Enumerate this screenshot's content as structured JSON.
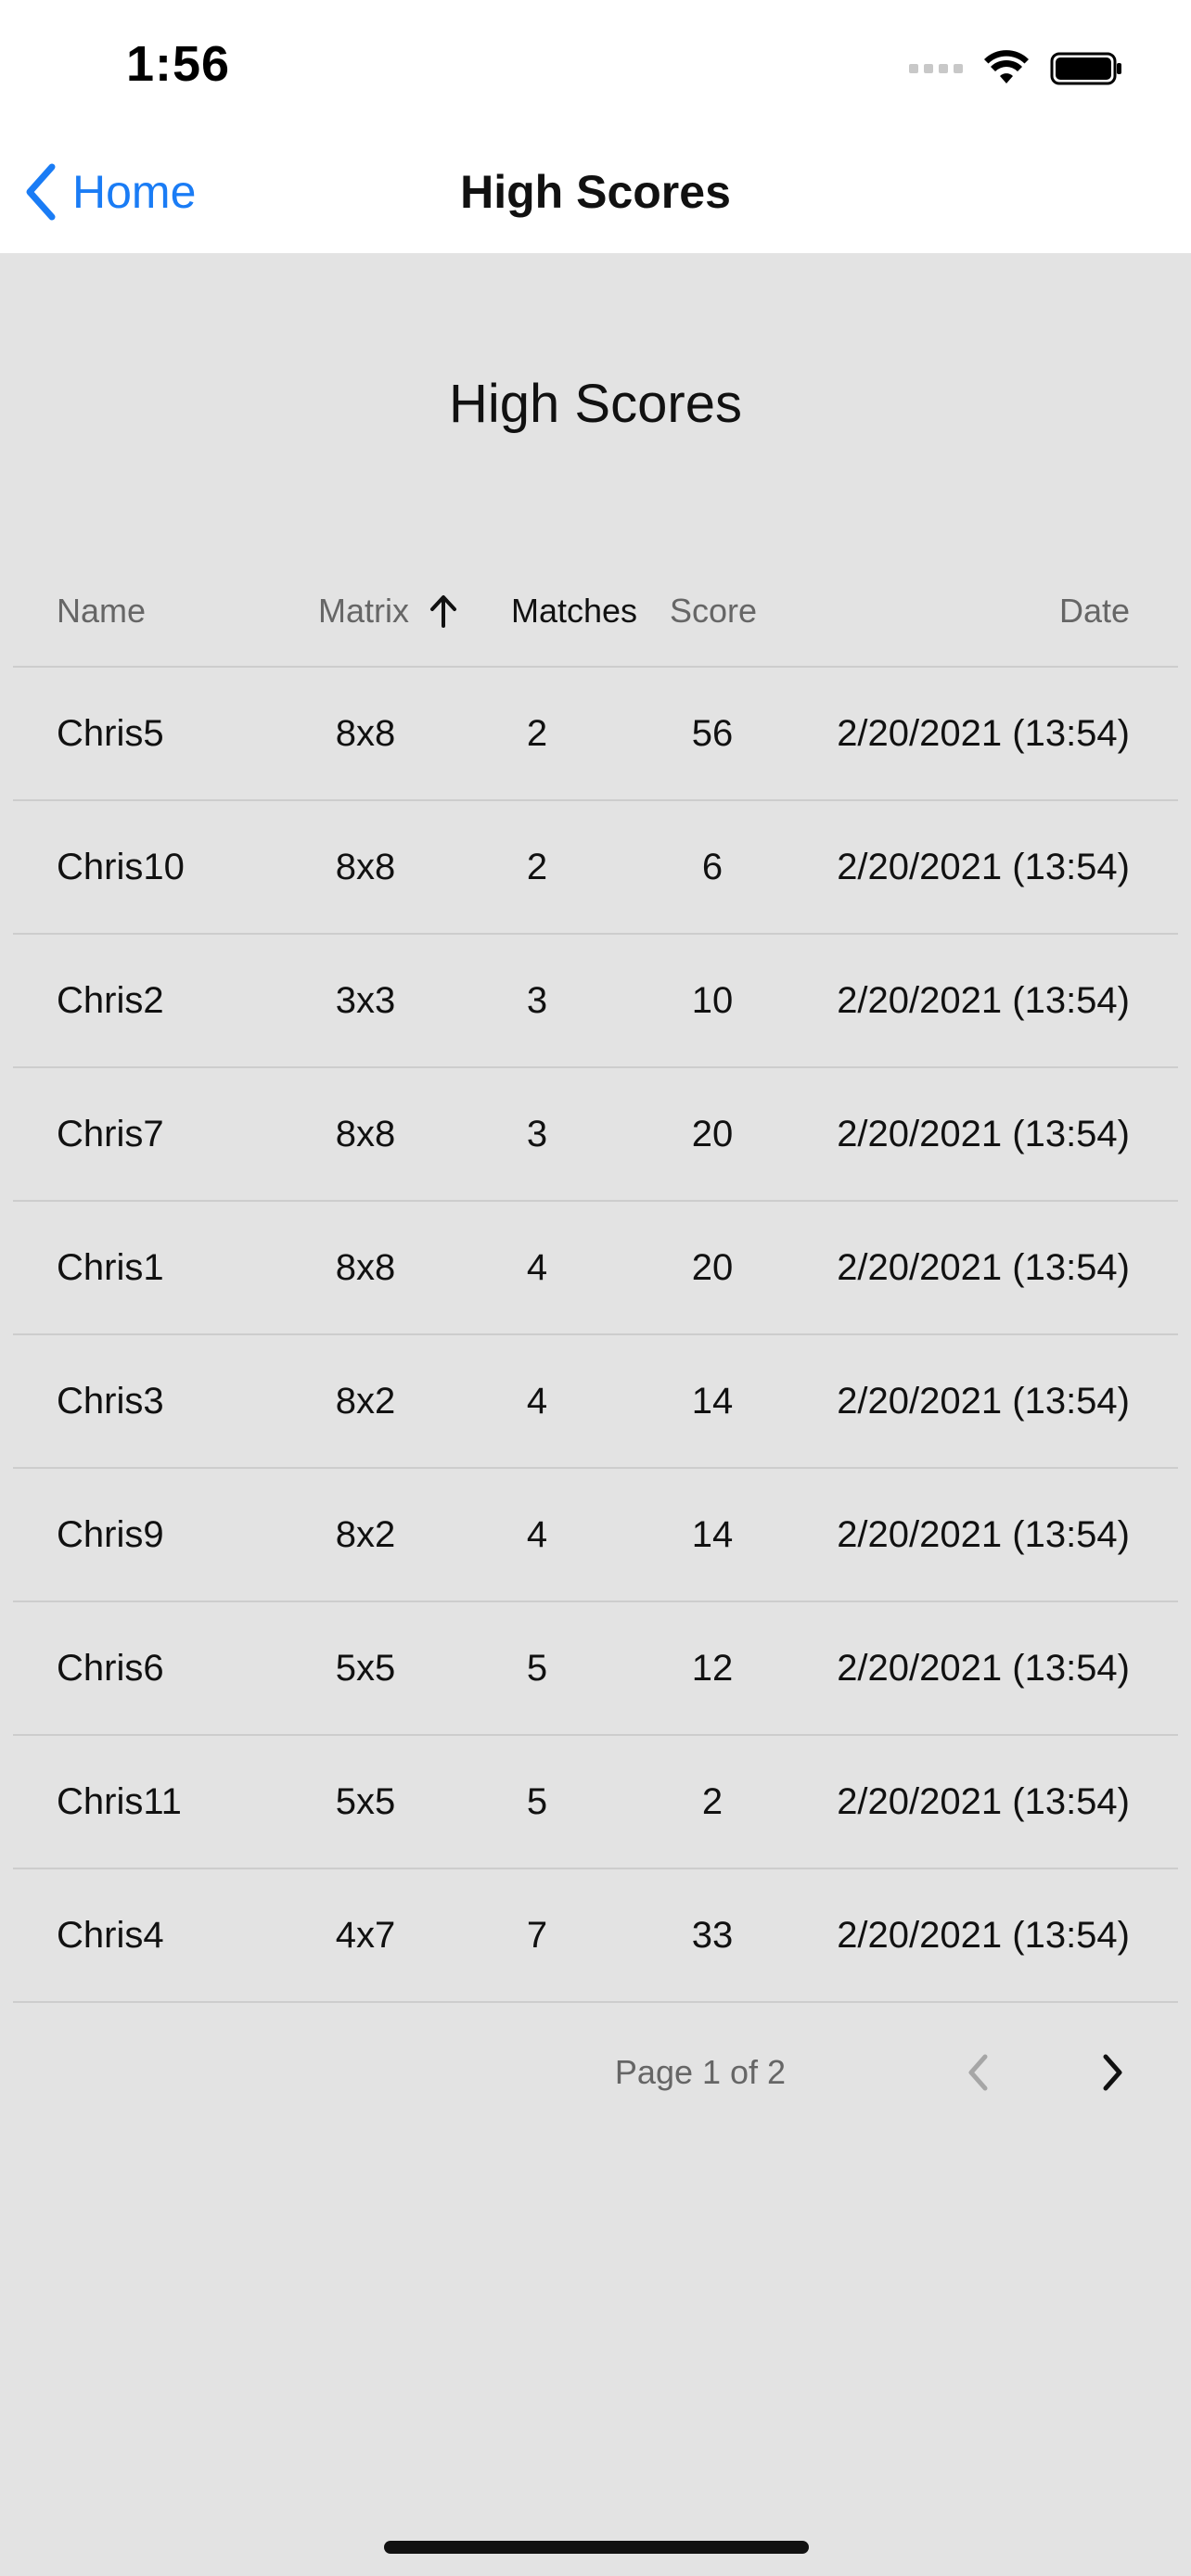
{
  "status_bar": {
    "time": "1:56"
  },
  "nav": {
    "back_label": "Home",
    "title": "High Scores"
  },
  "page": {
    "heading": "High Scores"
  },
  "table": {
    "columns": {
      "name": "Name",
      "matrix": "Matrix",
      "matches": "Matches",
      "score": "Score",
      "date": "Date"
    },
    "sorted_column": "matches",
    "sort_direction": "ascending",
    "rows": [
      {
        "name": "Chris5",
        "matrix": "8x8",
        "matches": "2",
        "score": "56",
        "date": "2/20/2021 (13:54)"
      },
      {
        "name": "Chris10",
        "matrix": "8x8",
        "matches": "2",
        "score": "6",
        "date": "2/20/2021 (13:54)"
      },
      {
        "name": "Chris2",
        "matrix": "3x3",
        "matches": "3",
        "score": "10",
        "date": "2/20/2021 (13:54)"
      },
      {
        "name": "Chris7",
        "matrix": "8x8",
        "matches": "3",
        "score": "20",
        "date": "2/20/2021 (13:54)"
      },
      {
        "name": "Chris1",
        "matrix": "8x8",
        "matches": "4",
        "score": "20",
        "date": "2/20/2021 (13:54)"
      },
      {
        "name": "Chris3",
        "matrix": "8x2",
        "matches": "4",
        "score": "14",
        "date": "2/20/2021 (13:54)"
      },
      {
        "name": "Chris9",
        "matrix": "8x2",
        "matches": "4",
        "score": "14",
        "date": "2/20/2021 (13:54)"
      },
      {
        "name": "Chris6",
        "matrix": "5x5",
        "matches": "5",
        "score": "12",
        "date": "2/20/2021 (13:54)"
      },
      {
        "name": "Chris11",
        "matrix": "5x5",
        "matches": "5",
        "score": "2",
        "date": "2/20/2021 (13:54)"
      },
      {
        "name": "Chris4",
        "matrix": "4x7",
        "matches": "7",
        "score": "33",
        "date": "2/20/2021 (13:54)"
      }
    ]
  },
  "pager": {
    "label": "Page 1 of 2",
    "prev_enabled": false,
    "next_enabled": true
  },
  "colors": {
    "accent": "#1a7cf5",
    "background": "#e3e3e3",
    "bar_background": "#ffffff",
    "divider": "#cdcdcd",
    "muted_text": "#666666"
  },
  "icons": {
    "back": "chevron-left-icon",
    "sort": "arrow-up-icon",
    "prev": "chevron-left-icon",
    "next": "chevron-right-icon",
    "wifi": "wifi-icon",
    "battery": "battery-icon",
    "signal": "cellular-signal-icon"
  }
}
